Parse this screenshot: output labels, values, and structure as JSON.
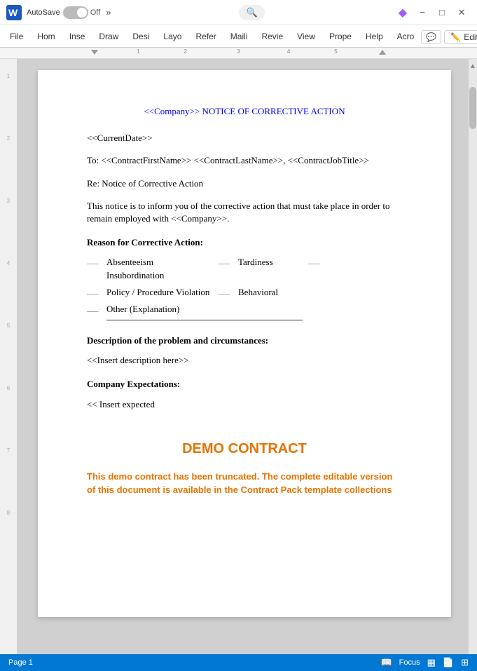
{
  "titlebar": {
    "app_icon": "W",
    "autosave_label": "AutoSave",
    "toggle_state": "Off",
    "more_arrows": "»",
    "search_placeholder": "Search",
    "minimize_label": "−",
    "maximize_label": "□",
    "close_label": "✕"
  },
  "ribbon": {
    "tabs": [
      "File",
      "Home",
      "Insert",
      "Draw",
      "Design",
      "Layout",
      "References",
      "Mailings",
      "Review",
      "View",
      "Properties",
      "Help",
      "Acrobat"
    ],
    "tab_short": [
      "File",
      "Hom",
      "Inse",
      "Draw",
      "Desi",
      "Layo",
      "Refer",
      "Maili",
      "Revie",
      "View",
      "Prope",
      "Help",
      "Acro"
    ],
    "comment_label": "💬",
    "editing_label": "Editing",
    "editing_chevron": "▾"
  },
  "ruler": {
    "marks": [
      "1",
      "2",
      "3",
      "4",
      "5"
    ]
  },
  "left_margin": {
    "marks": [
      "1",
      "2",
      "3",
      "4",
      "5",
      "6",
      "7",
      "8"
    ]
  },
  "document": {
    "title": "<<Company>> NOTICE OF CORRECTIVE ACTION",
    "date_field": "<<CurrentDate>>",
    "to_line": "To: <<ContractFirstName>> <<ContractLastName>>, <<ContractJobTitle>>",
    "re_line": "Re: Notice of Corrective Action",
    "body_text": "This notice is to inform you of the corrective action that must take place in order to remain employed with <<Company>>.",
    "reason_label": "Reason for Corrective Action:",
    "checkboxes": [
      {
        "mark": "___",
        "label": "Absenteeism"
      },
      {
        "mark": "___",
        "label": "Tardiness",
        "mark2": "___"
      },
      {
        "mark": "___",
        "label": "Insubordination"
      },
      {
        "mark": "___",
        "label": "Policy / Procedure Violation",
        "mark2": "___",
        "label2": "Behavioral"
      },
      {
        "mark": "___",
        "label": "Other (Explanation)"
      }
    ],
    "description_label": "Description of the problem and circumstances:",
    "description_field": "<<Insert description here>>",
    "expectations_label": "Company Expectations:",
    "insert_expected": "<< Insert expected"
  },
  "demo": {
    "title": "DEMO CONTRACT",
    "text": "This demo contract has been truncated. The complete editable version of this document is available in the Contract Pack template collections"
  },
  "statusbar": {
    "page_label": "Page 1"
  }
}
